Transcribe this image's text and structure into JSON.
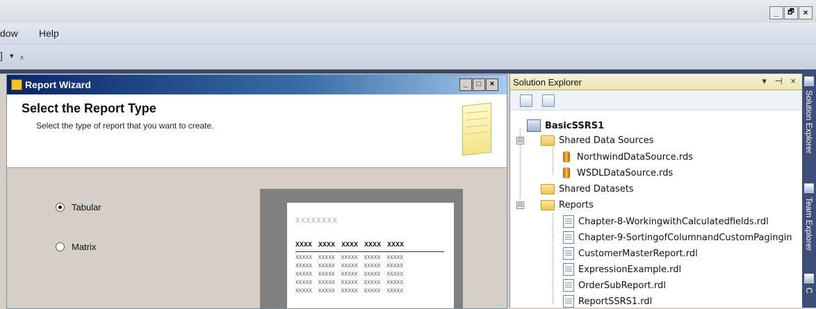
{
  "window": {
    "controls": [
      "_",
      "🗗",
      "×"
    ]
  },
  "menubar": {
    "items": [
      "dow",
      "Help"
    ]
  },
  "toolbar": {
    "glyph": "]",
    "dropdown": "▾",
    "more": "⩡"
  },
  "wizard": {
    "title": "Report Wizard",
    "controls": [
      "_",
      "□",
      "×"
    ],
    "header": "Select the Report Type",
    "subheader": "Select the type of report that you want to create.",
    "options": [
      {
        "label": "Tabular",
        "selected": true
      },
      {
        "label": "Matrix",
        "selected": false
      }
    ],
    "preview": {
      "title": "XXXXXXXX",
      "header_cells": [
        "XXXX",
        "XXXX",
        "XXXX",
        "XXXX",
        "XXXX"
      ],
      "rows": [
        "XXXXX XXXXX XXXXX XXXXX XXXXX",
        "XXXXX XXXXX XXXXX XXXXX XXXXX",
        "XXXXX XXXXX XXXXX XXXXX XXXXX",
        "XXXXX XXXXX XXXXX XXXXX XXXXX",
        "XXXXX XXXXX XXXXX XXXXX XXXXX"
      ]
    }
  },
  "solution_explorer": {
    "title": "Solution Explorer",
    "controls": "▾ ⊣ ×",
    "project": "BasicSSRS1",
    "shared_data_sources": {
      "label": "Shared Data Sources",
      "items": [
        "NorthwindDataSource.rds",
        "WSDLDataSource.rds"
      ]
    },
    "shared_datasets": {
      "label": "Shared Datasets"
    },
    "reports": {
      "label": "Reports",
      "items": [
        "Chapter-8-WorkingwithCalculatedfields.rdl",
        "Chapter-9-SortingofColumnandCustomPagingin",
        "CustomerMasterReport.rdl",
        "ExpressionExample.rdl",
        "OrderSubReport.rdl",
        "ReportSSRS1.rdl"
      ]
    },
    "expanders": [
      "⊟",
      "⊟"
    ]
  },
  "side_tabs": [
    "Solution Explorer",
    "Team Explorer",
    "C"
  ]
}
